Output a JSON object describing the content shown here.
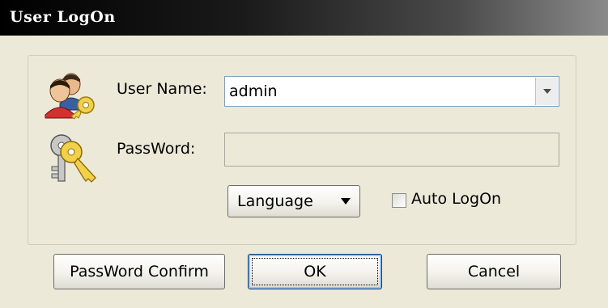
{
  "window": {
    "title": "User LogOn"
  },
  "form": {
    "username_label": "User Name:",
    "username_value": "admin",
    "password_label": "PassWord:",
    "password_value": "",
    "language_button": "Language",
    "auto_logon_label": "Auto LogOn",
    "auto_logon_checked": false
  },
  "buttons": {
    "password_confirm": "PassWord Confirm",
    "ok": "OK",
    "cancel": "Cancel"
  },
  "icons": {
    "user": "users-key-icon",
    "password": "keys-icon",
    "dropdown": "chevron-down-icon"
  },
  "colors": {
    "titlebar_start": "#000000",
    "titlebar_end": "#8a8a8a",
    "window_bg": "#ece9d8",
    "input_border": "#7f9db9"
  }
}
